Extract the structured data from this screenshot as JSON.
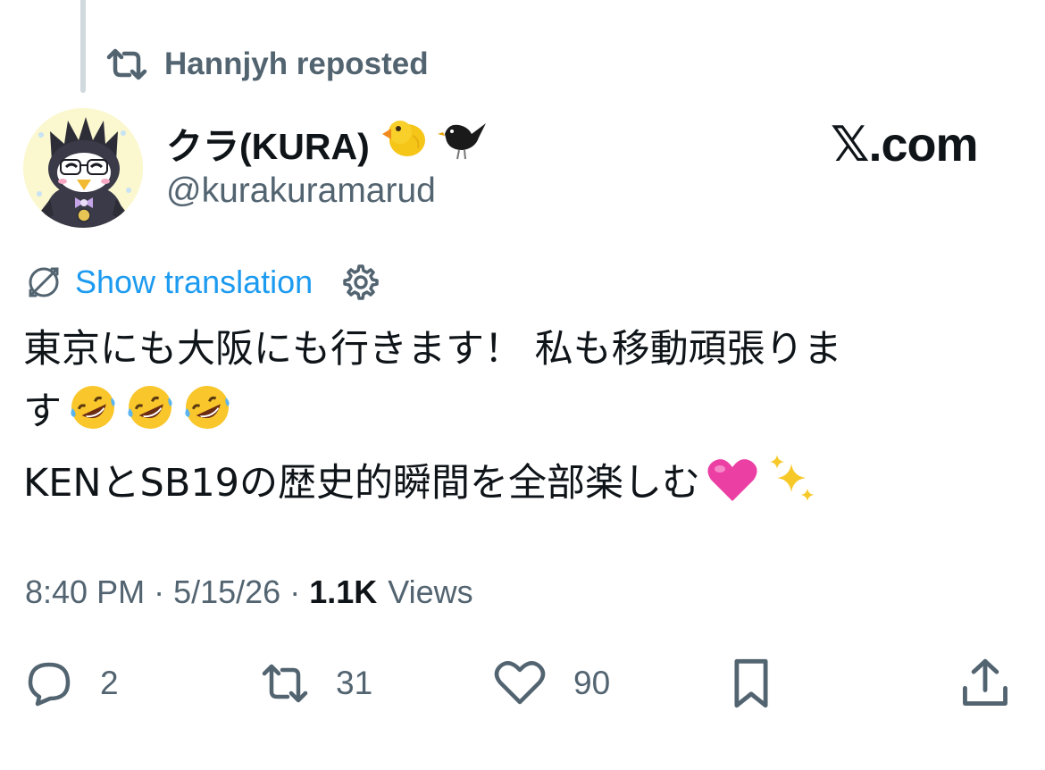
{
  "repost_header": {
    "text": "Hannjyh reposted"
  },
  "author": {
    "display_name": "クラ(KURA)",
    "emojis": [
      "chick-emoji",
      "blackbird-emoji"
    ],
    "handle": "@kurakuramarud"
  },
  "brand": {
    "label": "𝕏.com"
  },
  "translation": {
    "label": "Show translation"
  },
  "tweet": {
    "line1": "東京にも大阪にも行きます！ 私も移動頑張りま",
    "line2": "す",
    "line2_emojis": [
      "rolling-laughing-emoji",
      "rolling-laughing-emoji",
      "rolling-laughing-emoji"
    ],
    "line3": "KENとSB19の歴史的瞬間を全部楽しむ",
    "line3_emojis": [
      "pink-heart-emoji",
      "sparkles-emoji"
    ]
  },
  "meta": {
    "time": "8:40 PM",
    "separator": "·",
    "date": "5/15/26",
    "views_count": "1.1K",
    "views_label": "Views"
  },
  "actions": {
    "replies": "2",
    "reposts": "31",
    "likes": "90"
  },
  "colors": {
    "text_primary": "#0f1419",
    "text_secondary": "#536471",
    "link": "#1d9bf0",
    "thread_line": "#cfd9de"
  }
}
